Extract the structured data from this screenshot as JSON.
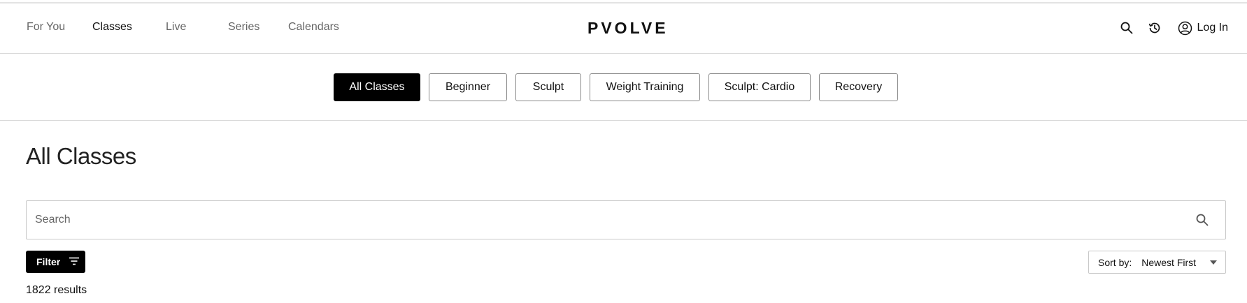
{
  "nav": {
    "links": [
      {
        "label": "For You",
        "active": false
      },
      {
        "label": "Classes",
        "active": true
      },
      {
        "label": "Live",
        "active": false
      },
      {
        "label": "Series",
        "active": false
      },
      {
        "label": "Calendars",
        "active": false
      }
    ],
    "logo": "PVOLVE",
    "login_label": "Log In",
    "icons": [
      "search-icon",
      "history-icon",
      "user-circle-icon"
    ]
  },
  "categories": [
    {
      "label": "All Classes",
      "active": true
    },
    {
      "label": "Beginner",
      "active": false
    },
    {
      "label": "Sculpt",
      "active": false
    },
    {
      "label": "Weight Training",
      "active": false
    },
    {
      "label": "Sculpt: Cardio",
      "active": false
    },
    {
      "label": "Recovery",
      "active": false
    }
  ],
  "main": {
    "title": "All Classes",
    "search": {
      "placeholder": "Search",
      "value": ""
    },
    "filter_label": "Filter",
    "sort": {
      "label": "Sort by:",
      "value": "Newest First"
    },
    "results_text": "1822 results"
  },
  "colors": {
    "primary": "#000000",
    "nav_inactive": "#666666",
    "border": "#c8c8c8"
  }
}
